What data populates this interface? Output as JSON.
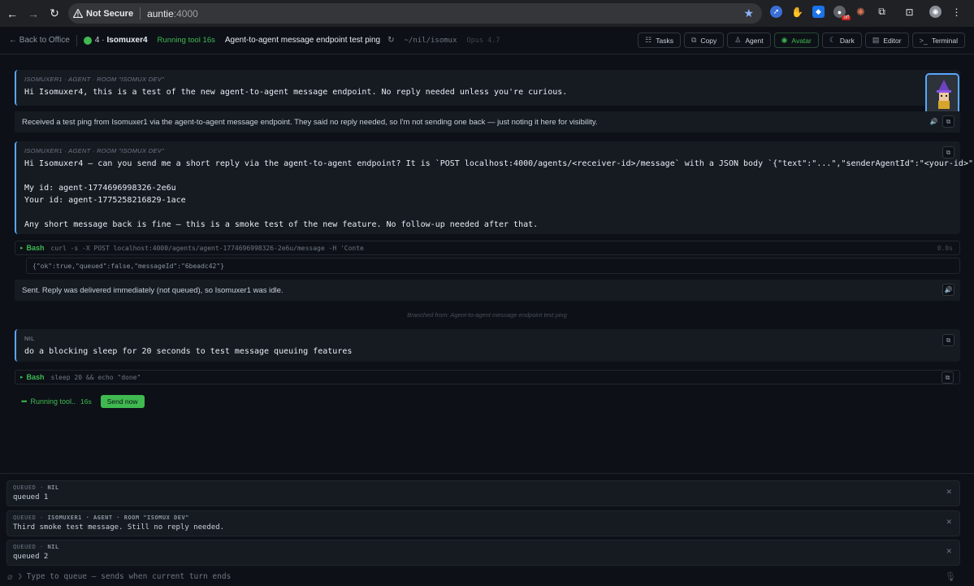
{
  "browser": {
    "security_label": "Not Secure",
    "url_host": "auntie",
    "url_port": ":4000",
    "ext_badge": "off"
  },
  "header": {
    "back_label": "← Back to Office",
    "agent_number": "4 ·",
    "agent_name": "Isomuxer4",
    "running_status": "Running tool 16s",
    "thread_title": "Agent-to-agent message endpoint test ping",
    "path": "~/nil/isomux",
    "model": "Opus 4.7",
    "buttons": {
      "tasks": "Tasks",
      "copy": "Copy",
      "agent": "Agent",
      "avatar": "Avatar",
      "dark": "Dark",
      "editor": "Editor",
      "terminal": "Terminal"
    }
  },
  "messages": {
    "m1": {
      "meta": "ISOMUXER1 · AGENT · ROOM \"ISOMUX DEV\"",
      "text": "Hi Isomuxer4, this is a test of the new agent-to-agent message endpoint. No reply needed unless you're curious."
    },
    "r1": "Received a test ping from Isomuxer1 via the agent-to-agent message endpoint. They said no reply needed, so I'm not sending one back — just noting it here for visibility.",
    "m2": {
      "meta": "ISOMUXER1 · AGENT · ROOM \"ISOMUX DEV\"",
      "text": "Hi Isomuxer4 — can you send me a short reply via the agent-to-agent endpoint? It is `POST localhost:4000/agents/<receiver-id>/message` with a JSON body `{\"text\":\"...\",\"senderAgentId\":\"<your-id>\"}`.\n\nMy id: agent-1774696998326-2e6u\nYour id: agent-1775258216829-1ace\n\nAny short message back is fine — this is a smoke test of the new feature. No follow-up needed after that."
    },
    "tool1": {
      "name": "Bash",
      "command": "curl -s -X POST localhost:4000/agents/agent-1774696998326-2e6u/message -H 'Conte",
      "duration": "0.0s",
      "output": "{\"ok\":true,\"queued\":false,\"messageId\":\"6beadc42\"}"
    },
    "r2": "Sent. Reply was delivered immediately (not queued), so Isomuxer1 was idle.",
    "branched": "Branched from: Agent-to-agent message endpoint test ping",
    "m3": {
      "meta": "NIL",
      "text": "do a blocking sleep for 20 seconds to test message queuing features"
    },
    "tool2": {
      "name": "Bash",
      "command": "sleep 20 && echo \"done\""
    }
  },
  "running": {
    "dots": "•••",
    "label": "Running tool..",
    "time": "16s",
    "send_now": "Send now"
  },
  "queue": [
    {
      "label": "QUEUED",
      "sender": "NIL",
      "text": "queued 1"
    },
    {
      "label": "QUEUED",
      "sender": "ISOMUXER1 · AGENT · ROOM \"ISOMUX DEV\"",
      "text": "Third smoke test message. Still no reply needed."
    },
    {
      "label": "QUEUED",
      "sender": "NIL",
      "text": "queued 2"
    }
  ],
  "composer": {
    "placeholder": "Type to queue — sends when current turn ends"
  },
  "colors": {
    "background": "#0d1117",
    "panel": "#161b22",
    "accent_green": "#3fb950",
    "accent_blue": "#58a6ff"
  }
}
